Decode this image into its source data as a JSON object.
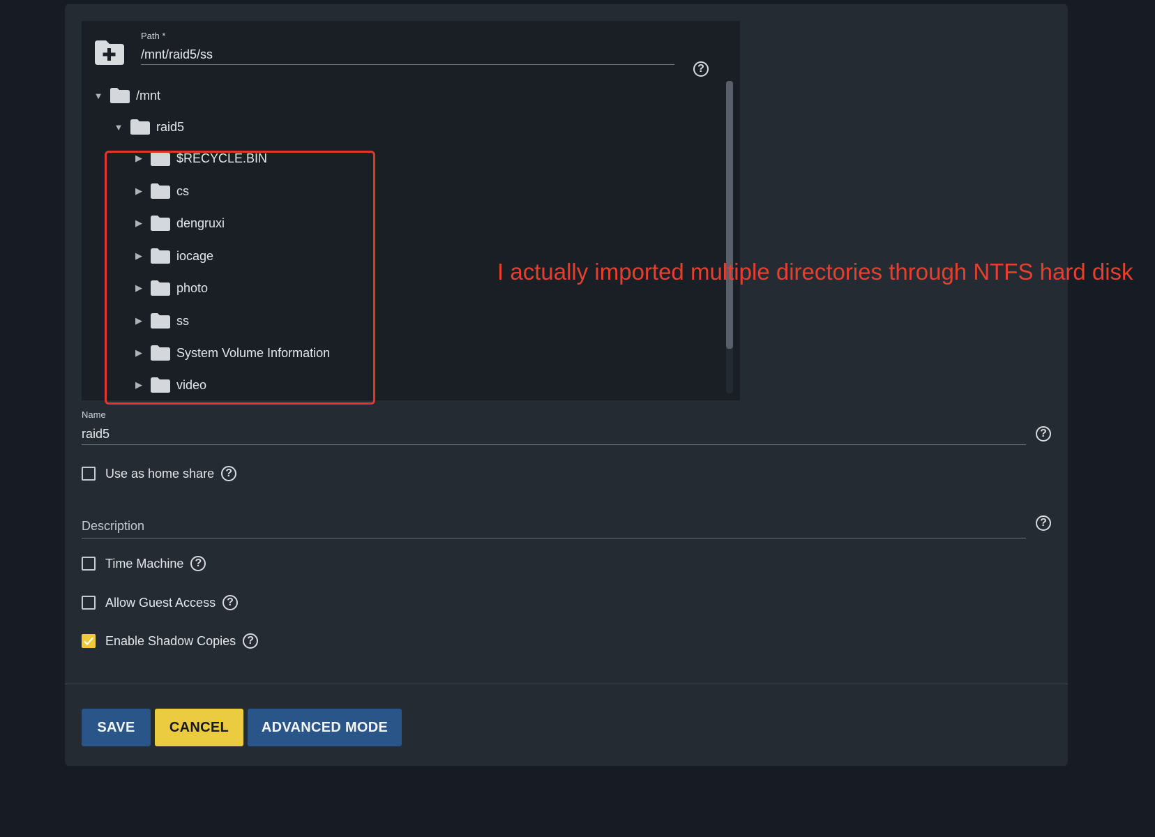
{
  "path_selector": {
    "label": "Path *",
    "value": "/mnt/raid5/ss",
    "tree": {
      "root": "/mnt",
      "child": "raid5",
      "items": [
        "$RECYCLE.BIN",
        "cs",
        "dengruxi",
        "iocage",
        "photo",
        "ss",
        "System Volume Information",
        "video"
      ]
    }
  },
  "annotation": "I actually imported multiple directories through NTFS hard disk",
  "name_field": {
    "label": "Name",
    "value": "raid5"
  },
  "description_field": {
    "placeholder": "Description"
  },
  "checkboxes": {
    "home_share": {
      "label": "Use as home share",
      "checked": false
    },
    "time_machine": {
      "label": "Time Machine",
      "checked": false
    },
    "guest_access": {
      "label": "Allow Guest Access",
      "checked": false
    },
    "shadow_copies": {
      "label": "Enable Shadow Copies",
      "checked": true
    }
  },
  "buttons": {
    "save": "SAVE",
    "cancel": "CANCEL",
    "advanced": "ADVANCED MODE"
  },
  "help_glyph": "?",
  "icons": [
    "add-folder-icon",
    "folder-icon",
    "help-icon",
    "caret-right-icon",
    "caret-down-icon",
    "check-icon"
  ],
  "colors": {
    "accent": "#f0c93b",
    "primary": "#2a5589",
    "annotation": "#e5402e"
  }
}
